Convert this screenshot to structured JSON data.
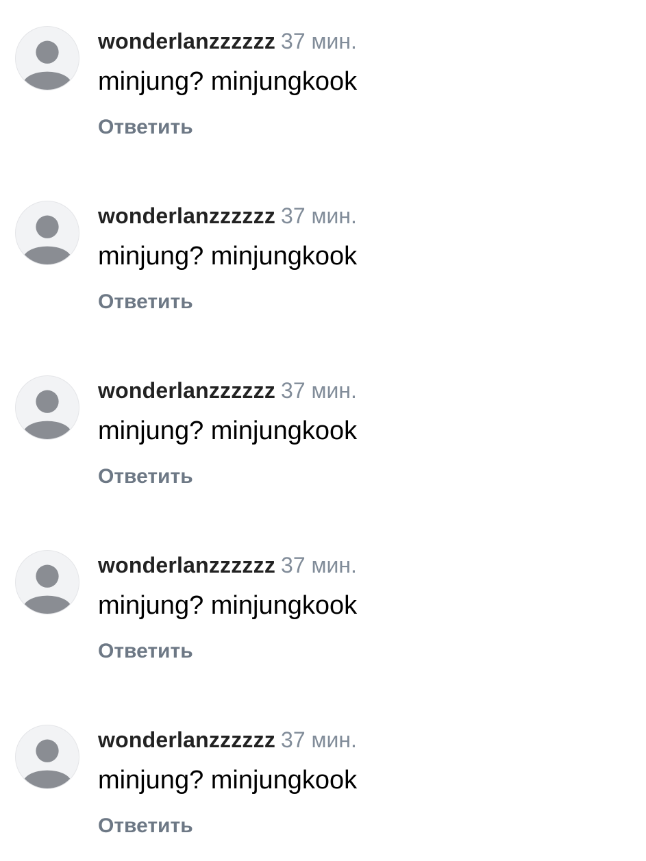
{
  "comments": [
    {
      "author": "wonderlanzzzzzz",
      "time": "37 мин.",
      "text": "minjung? minjungkook",
      "reply_label": "Ответить",
      "avatar_icon": "default-user-icon"
    },
    {
      "author": "wonderlanzzzzzz",
      "time": "37 мин.",
      "text": "minjung? minjungkook",
      "reply_label": "Ответить",
      "avatar_icon": "default-user-icon"
    },
    {
      "author": "wonderlanzzzzzz",
      "time": "37 мин.",
      "text": "minjung? minjungkook",
      "reply_label": "Ответить",
      "avatar_icon": "default-user-icon"
    },
    {
      "author": "wonderlanzzzzzz",
      "time": "37 мин.",
      "text": "minjung? minjungkook",
      "reply_label": "Ответить",
      "avatar_icon": "default-user-icon"
    },
    {
      "author": "wonderlanzzzzzz",
      "time": "37 мин.",
      "text": "minjung? minjungkook",
      "reply_label": "Ответить",
      "avatar_icon": "default-user-icon"
    }
  ],
  "colors": {
    "author": "#222222",
    "time": "#818c99",
    "text": "#000000",
    "reply": "#6d7885",
    "avatar_bg": "#f2f3f5",
    "avatar_glyph": "#8a8d93"
  }
}
